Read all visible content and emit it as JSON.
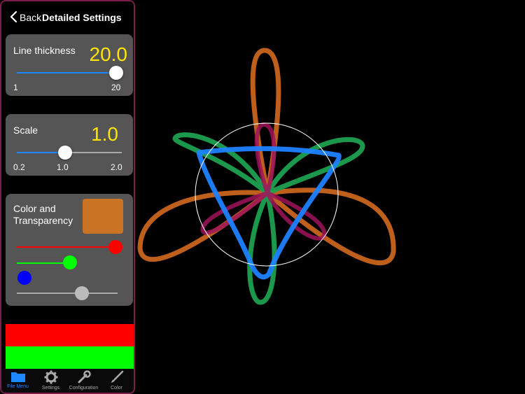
{
  "navbar": {
    "back_label": "Back",
    "title": "Detailed Settings"
  },
  "line_thickness": {
    "label": "Line thickness",
    "value": "20.0",
    "min_label": "1",
    "max_label": "20",
    "fraction": 1.0
  },
  "scale": {
    "label": "Scale",
    "value": "1.0",
    "min_label": "0.2",
    "mid_label": "1.0",
    "max_label": "2.0",
    "fraction": 0.44
  },
  "color": {
    "label_line1": "Color and",
    "label_line2": "Transparency",
    "swatch_color": "#c87424",
    "red_fraction": 1.0,
    "green_fraction": 0.5,
    "blue_fraction": 0.0,
    "alpha_fraction": 0.62
  },
  "tabs": [
    {
      "label": "File Menu",
      "active": true
    },
    {
      "label": "Settings",
      "active": false
    },
    {
      "label": "Configuration",
      "active": false
    },
    {
      "label": "Color",
      "active": false
    }
  ],
  "colors": {
    "accent": "#ffe600",
    "tab_active": "#1e88ff",
    "frame": "#7a1f4a",
    "orange": "#c8641e",
    "green": "#1ea050",
    "magenta": "#a0145a",
    "blue": "#1e82ff"
  }
}
